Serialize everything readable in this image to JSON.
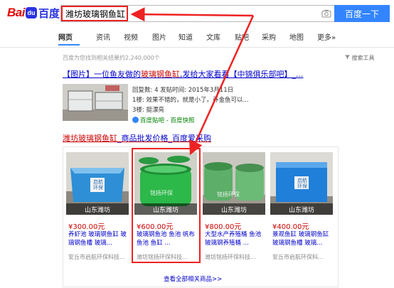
{
  "header": {
    "logo_text_bai": "Bai",
    "logo_paw": "du",
    "logo_text_du": "百度",
    "query": "潍坊玻璃钢鱼缸",
    "search_button": "百度一下"
  },
  "nav": {
    "tabs": [
      "网页",
      "资讯",
      "视频",
      "图片",
      "知道",
      "文库",
      "贴吧",
      "采购",
      "地图",
      "更多»"
    ],
    "active": "网页"
  },
  "stats": "百度为您找到相关结果约2,240,000个",
  "search_tools": "搜索工具",
  "result1": {
    "title_pre": "【图片】一位鱼友做的",
    "title_em": "玻璃钢鱼缸",
    "title_post": ",发给大家看看【中锦俱乐部吧】_...",
    "meta_line1": "回复数: 4 发贴时间: 2015年3月11日",
    "meta_line2": "1楼: 效果不错的，就是小了。养金鱼可以...",
    "meta_line3": "3楼: 挺漂亮",
    "source": "百度贴吧 - 百度快照"
  },
  "result2": {
    "title_em": "潍坊玻璃钢鱼缸",
    "title_post": "_商品批发价格_百度爱采购"
  },
  "products": [
    {
      "price": "¥300.00元",
      "title": "养虾池 玻璃钢鱼缸 玻璃钢鱼槽 玻璃...",
      "shop": "安丘市启航环保科技...",
      "loc": "山东潍坊",
      "label": "启航环保",
      "color": "#2e8fd6"
    },
    {
      "price": "¥600.00元",
      "title": "玻璃钢鱼池 鱼池 帆布鱼池 鱼缸 ...",
      "shop": "潍坊铭扬环保科技...",
      "loc": "山东潍坊",
      "label": "铭扬环保",
      "color": "#2db84a"
    },
    {
      "price": "¥800.00元",
      "title": "大型水产养殖桶 鱼池 玻璃钢养殖桶 ...",
      "shop": "潍坊铭扬环保科技...",
      "loc": "山东潍坊",
      "label": "铭扬环保",
      "color": "#5cae68"
    },
    {
      "price": "¥400.00元",
      "title": "景观鱼缸 玻璃钢鱼缸 玻璃钢鱼槽 玻璃...",
      "shop": "安丘市启航环保科...",
      "loc": "山东潍坊",
      "label": "启航环保",
      "color": "#1f7fd9"
    }
  ],
  "more_products": "查看全部相关商品>>",
  "colors": {
    "brand_blue": "#3385ff",
    "link": "#0000cc",
    "highlight": "#cc0000",
    "annotation": "#ee2222"
  }
}
